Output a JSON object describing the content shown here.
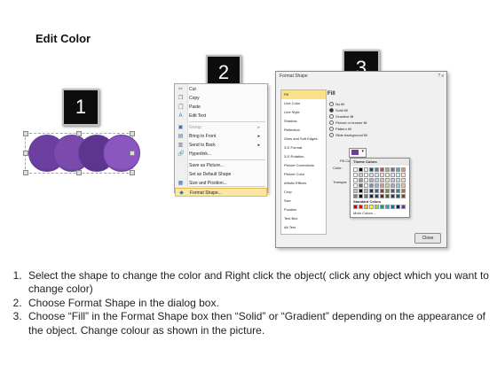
{
  "title": "Edit Color",
  "badges": {
    "step1": "1",
    "step2": "2",
    "step3": "3"
  },
  "circles": {
    "colors": [
      "#6b3fa0",
      "#7a4aad",
      "#5d358f",
      "#8a57c0"
    ]
  },
  "context_menu": {
    "items": [
      {
        "label": "Cut",
        "icon": "✂"
      },
      {
        "label": "Copy",
        "icon": "❐"
      },
      {
        "label": "Paste",
        "icon": "📋"
      },
      {
        "label": "Edit Text",
        "icon": "A"
      },
      {
        "label": "Group",
        "icon": "▣"
      },
      {
        "label": "Bring to Front",
        "icon": "▤"
      },
      {
        "label": "Send to Back",
        "icon": "▥"
      },
      {
        "label": "Hyperlink...",
        "icon": "🔗"
      },
      {
        "label": "Save as Picture...",
        "icon": ""
      },
      {
        "label": "Set as Default Shape",
        "icon": ""
      },
      {
        "label": "Size and Position...",
        "icon": "▦"
      },
      {
        "label": "Format Shape...",
        "icon": "◆"
      }
    ]
  },
  "format_dialog": {
    "title": "Format Shape",
    "window_buttons": "? x",
    "categories": [
      "Fill",
      "Line Color",
      "Line Style",
      "Shadow",
      "Reflection",
      "Glow and Soft Edges",
      "3-D Format",
      "3-D Rotation",
      "Picture Corrections",
      "Picture Color",
      "Artistic Effects",
      "Crop",
      "Size",
      "Position",
      "Text Box",
      "Alt Text"
    ],
    "fill_heading": "Fill",
    "fill_options": [
      "No fill",
      "Solid fill",
      "Gradient fill",
      "Picture or texture fill",
      "Pattern fill",
      "Slide background fill"
    ],
    "fill_color_label": "Fill Color",
    "color_label": "Color:",
    "transparency_label": "Transpar",
    "close_label": "Close"
  },
  "color_popup": {
    "theme_label": "Theme Colors",
    "standard_label": "Standard Colors",
    "more_label": "More Colors..."
  },
  "instructions": [
    "Select the shape to change the color and Right click the object( click any object which you want to change color)",
    "Choose Format Shape in the dialog box.",
    "Choose “Fill” in the Format Shape box then “Solid” or “Gradient” depending on the appearance of the object. Change colour as shown in the picture."
  ]
}
